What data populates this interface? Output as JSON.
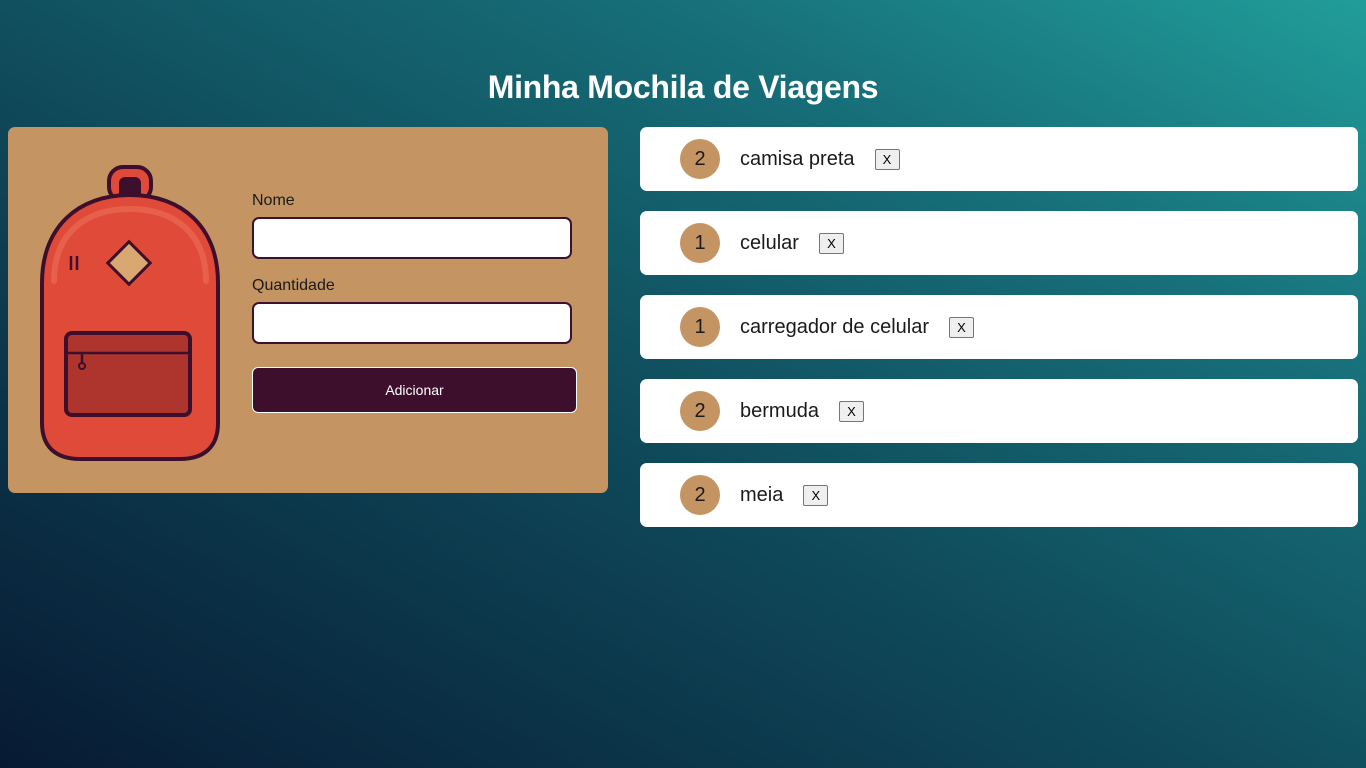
{
  "page": {
    "title": "Minha Mochila de Viagens"
  },
  "form": {
    "nome_label": "Nome",
    "nome_value": "",
    "quantidade_label": "Quantidade",
    "quantidade_value": "",
    "submit_label": "Adicionar"
  },
  "items": [
    {
      "quantity": "2",
      "name": "camisa preta",
      "delete_label": "X"
    },
    {
      "quantity": "1",
      "name": "celular",
      "delete_label": "X"
    },
    {
      "quantity": "1",
      "name": "carregador de celular",
      "delete_label": "X"
    },
    {
      "quantity": "2",
      "name": "bermuda",
      "delete_label": "X"
    },
    {
      "quantity": "2",
      "name": "meia",
      "delete_label": "X"
    }
  ],
  "colors": {
    "card_tan": "#c49562",
    "accent_plum": "#3d0f2d",
    "backpack_red": "#e04a38",
    "background_teal": "#219d9a",
    "background_navy": "#071a33"
  },
  "icons": {
    "illustration": "backpack-icon"
  }
}
